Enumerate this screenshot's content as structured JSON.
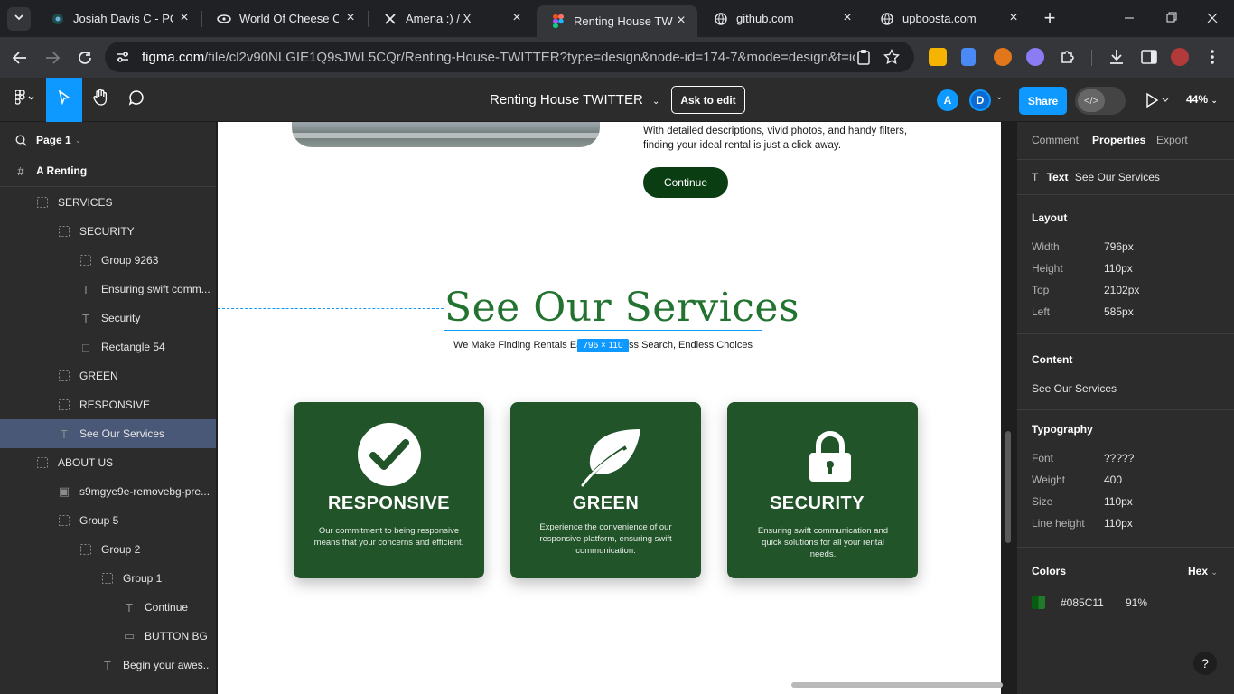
{
  "browser": {
    "tabs": [
      {
        "title": "Josiah Davis C - PORT",
        "icon": "portfolio-favicon"
      },
      {
        "title": "World Of Cheese Cak",
        "icon": "cheesecake-favicon"
      },
      {
        "title": "Amena :) / X",
        "icon": "x-favicon"
      },
      {
        "title": "Renting House TWITT",
        "icon": "figma-favicon"
      },
      {
        "title": "github.com",
        "icon": "globe-favicon"
      },
      {
        "title": "upboosta.com",
        "icon": "globe-favicon"
      }
    ],
    "url_host": "figma.com",
    "url_path": "/file/cl2v90NLGIE1Q9sJWL5CQr/Renting-House-TWITTER?type=design&node-id=174-7&mode=design&t=icGEp8..."
  },
  "figma": {
    "file_title": "Renting House TWITTER",
    "ask_to_edit": "Ask to edit",
    "avatars": [
      "A",
      "D"
    ],
    "share": "Share",
    "zoom": "44%"
  },
  "layers": {
    "page": "Page 1",
    "frame": "A Renting",
    "items": [
      {
        "label": "SERVICES",
        "icon": "group"
      },
      {
        "label": "SECURITY",
        "icon": "group"
      },
      {
        "label": "Group 9263",
        "icon": "group"
      },
      {
        "label": "Ensuring swift comm...",
        "icon": "text"
      },
      {
        "label": "Security",
        "icon": "text"
      },
      {
        "label": "Rectangle 54",
        "icon": "rect"
      },
      {
        "label": "GREEN",
        "icon": "group"
      },
      {
        "label": "RESPONSIVE",
        "icon": "group"
      },
      {
        "label": "See Our Services",
        "icon": "text"
      },
      {
        "label": "ABOUT US",
        "icon": "group"
      },
      {
        "label": "s9mgye9e-removebg-pre...",
        "icon": "image"
      },
      {
        "label": "Group 5",
        "icon": "group"
      },
      {
        "label": "Group 2",
        "icon": "group"
      },
      {
        "label": "Group 1",
        "icon": "group"
      },
      {
        "label": "Continue",
        "icon": "text"
      },
      {
        "label": "BUTTON BG",
        "icon": "line"
      },
      {
        "label": "Begin your awes...",
        "icon": "text"
      }
    ]
  },
  "canvas": {
    "about_text": "With detailed descriptions, vivid photos, and handy filters, finding your ideal rental is just a click away.",
    "continue_button": "Continue",
    "heading": "See Our Services",
    "subheading": "We Make Finding Rentals Easy: Effortless Search, Endless Choices",
    "size_badge": "796 × 110",
    "cards": [
      {
        "title": "RESPONSIVE",
        "desc": "Our commitment to being responsive means that your concerns and efficient.",
        "icon": "checkmark-icon"
      },
      {
        "title": "GREEN",
        "desc": "Experience the convenience of our responsive platform, ensuring swift communication.",
        "icon": "leaf-icon"
      },
      {
        "title": "SECURITY",
        "desc": "Ensuring swift communication and quick solutions for all your rental needs.",
        "icon": "padlock-icon"
      }
    ],
    "colors": {
      "card_green": "#225429",
      "heading_green": "#237330",
      "button_green": "#0b3d12"
    }
  },
  "properties": {
    "tabs": [
      "Comment",
      "Properties",
      "Export"
    ],
    "selection_type": "Text",
    "selection_name": "See Our Services",
    "layout_title": "Layout",
    "layout": [
      {
        "label": "Width",
        "value": "796px"
      },
      {
        "label": "Height",
        "value": "110px"
      },
      {
        "label": "Top",
        "value": "2102px"
      },
      {
        "label": "Left",
        "value": "585px"
      }
    ],
    "content_title": "Content",
    "content_value": "See Our Services",
    "typography_title": "Typography",
    "typography": [
      {
        "label": "Font",
        "value": "?????"
      },
      {
        "label": "Weight",
        "value": "400"
      },
      {
        "label": "Size",
        "value": "110px"
      },
      {
        "label": "Line height",
        "value": "110px"
      }
    ],
    "colors_title": "Colors",
    "color_format": "Hex",
    "color_hex": "#085C11",
    "color_opacity": "91%",
    "help": "?"
  }
}
